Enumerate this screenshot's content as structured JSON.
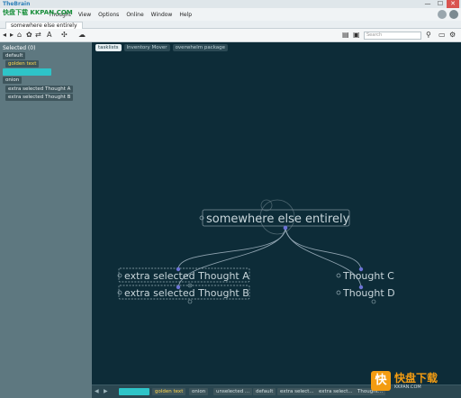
{
  "window": {
    "title": "TheBrain",
    "close_glyph": "✕",
    "max_glyph": "☐",
    "min_glyph": "—"
  },
  "watermark_top": "快盘下载 KKPAN.COM",
  "menu": {
    "items": [
      "Thought",
      "View",
      "Options",
      "Online",
      "Window",
      "Help"
    ]
  },
  "document_tab": "somewhere else entirely",
  "search": {
    "placeholder": "Search"
  },
  "left_panel": {
    "header": "Selected (0)",
    "tags": [
      {
        "label": "default",
        "style": "dark"
      },
      {
        "label": "golden text",
        "style": "gold"
      },
      {
        "label": "",
        "style": "teal"
      },
      {
        "label": "onion",
        "style": "dark"
      },
      {
        "label": "extra selected Thought A",
        "style": "dark"
      },
      {
        "label": "extra selected Thought B",
        "style": "dark"
      }
    ]
  },
  "canvas_tabs": [
    {
      "label": "tasklists",
      "active": true
    },
    {
      "label": "Inventory Mover",
      "active": false
    },
    {
      "label": "overwhelm package",
      "active": false
    }
  ],
  "mindmap": {
    "central": "somewhere else entirely",
    "left_children": [
      "extra selected Thought A",
      "extra selected Thought B"
    ],
    "right_children": [
      "Thought C",
      "Thought D"
    ]
  },
  "bottom_bar": {
    "chips": [
      {
        "label": "",
        "style": "teal"
      },
      {
        "label": "golden text",
        "style": "gold"
      },
      {
        "label": "onion",
        "style": "dark"
      },
      {
        "label": "unselected ...",
        "style": "dark"
      },
      {
        "label": "default",
        "style": "dark"
      },
      {
        "label": "extra select...",
        "style": "dark"
      },
      {
        "label": "extra select...",
        "style": "dark"
      },
      {
        "label": "Thought...",
        "style": "dark"
      }
    ]
  },
  "watermark": {
    "glyph": "快",
    "title": "快盘下载",
    "subtitle": "KKPAN.COM"
  },
  "colors": {
    "canvas_bg": "#0d2c38",
    "left_panel_bg": "#5e7880",
    "node_line": "#8fa3b0",
    "link_dot": "#6b73d6",
    "accent_teal": "#2ec4c8",
    "gold": "#ffd84d"
  }
}
